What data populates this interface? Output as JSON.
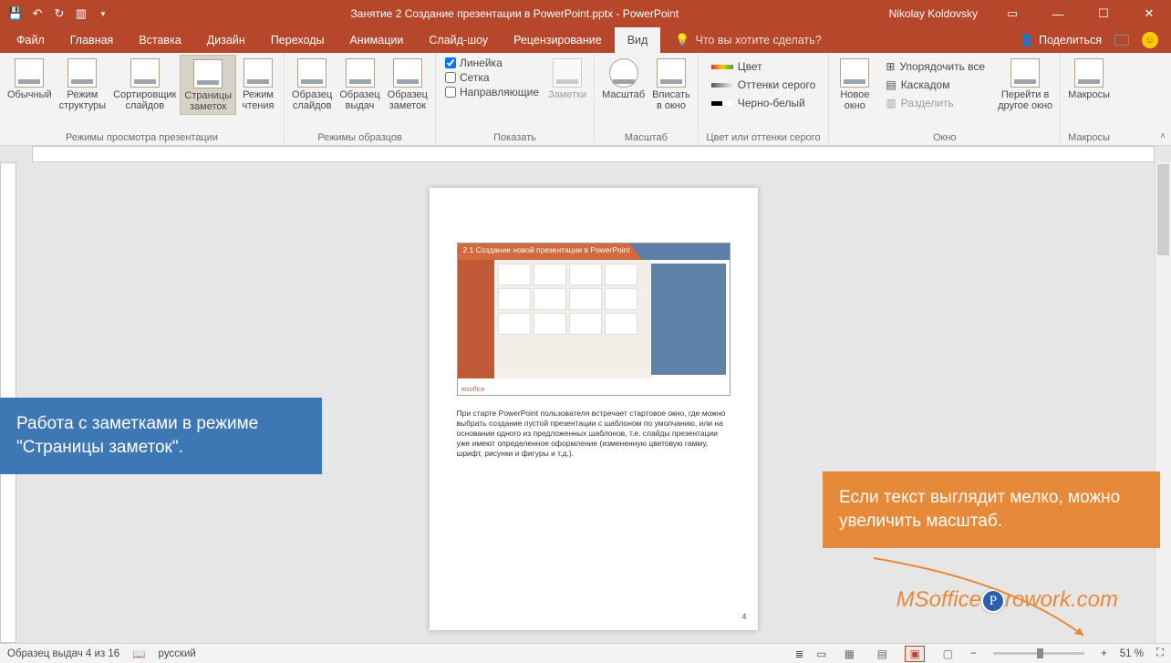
{
  "title": "Занятие 2 Создание презентации в PowerPoint.pptx  -  PowerPoint",
  "user": "Nikolay Koldovsky",
  "tabs": {
    "file": "Файл",
    "home": "Главная",
    "insert": "Вставка",
    "design": "Дизайн",
    "transitions": "Переходы",
    "animations": "Анимации",
    "slideshow": "Слайд-шоу",
    "review": "Рецензирование",
    "view": "Вид"
  },
  "tellme": "Что вы хотите сделать?",
  "share": "Поделиться",
  "ribbon": {
    "presViews": {
      "label": "Режимы просмотра презентации",
      "normal": "Обычный",
      "outline": "Режим\nструктуры",
      "sorter": "Сортировщик\nслайдов",
      "notes": "Страницы\nзаметок",
      "reading": "Режим\nчтения"
    },
    "masterViews": {
      "label": "Режимы образцов",
      "slideMaster": "Образец\nслайдов",
      "handoutMaster": "Образец\nвыдач",
      "notesMaster": "Образец\nзаметок"
    },
    "show": {
      "label": "Показать",
      "ruler": "Линейка",
      "gridlines": "Сетка",
      "guides": "Направляющие",
      "notesBtn": "Заметки"
    },
    "zoom": {
      "label": "Масштаб",
      "zoomBtn": "Масштаб",
      "fit": "Вписать\nв окно"
    },
    "color": {
      "label": "Цвет или оттенки серого",
      "color": "Цвет",
      "grayscale": "Оттенки серого",
      "bw": "Черно-белый"
    },
    "window": {
      "label": "Окно",
      "newWin": "Новое\nокно",
      "arrange": "Упорядочить все",
      "cascade": "Каскадом",
      "split": "Разделить",
      "switch": "Перейти в\nдругое окно"
    },
    "macros": {
      "label": "Макросы",
      "btn": "Макросы"
    }
  },
  "page": {
    "slideTitle": "2.1 Создание новой презентации в PowerPoint",
    "notes": "При старте PowerPoint пользователя встречает стартовое окно, где можно выбрать создание пустой презентации с шаблоном по умолчанию, или на основании одного из предложенных шаблонов, т.е. слайды презентации уже имеют определенное оформление (измененную цветовую гамму, шрифт, рисунки и фигуры и т.д.).",
    "num": "4"
  },
  "callouts": {
    "blue": "Работа с заметками в режиме \"Страницы заметок\".",
    "orange": "Если текст выглядит мелко, можно увеличить масштаб."
  },
  "watermark": {
    "pre": "MSoffice",
    "post": "rowork.com"
  },
  "status": {
    "slide": "Образец выдач 4 из 16",
    "lang": "русский",
    "zoom": "51 %"
  }
}
